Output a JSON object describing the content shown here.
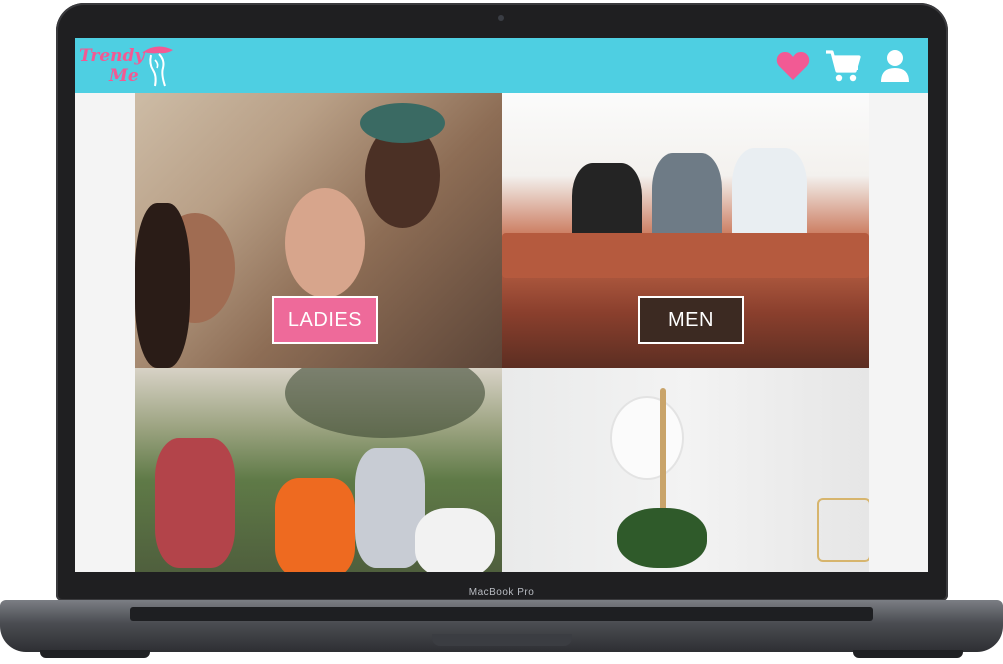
{
  "device": {
    "label": "MacBook Pro"
  },
  "header": {
    "logo_line1": "Trendy",
    "logo_line2": "Me",
    "bg_color": "#4ecfe2",
    "accent_color": "#f25a94",
    "icons": [
      "heart-icon",
      "cart-icon",
      "user-icon"
    ]
  },
  "categories": [
    {
      "label": "LADIES",
      "button_color": "#ee6a9a"
    },
    {
      "label": "MEN",
      "button_color": "#3c2a22"
    }
  ]
}
